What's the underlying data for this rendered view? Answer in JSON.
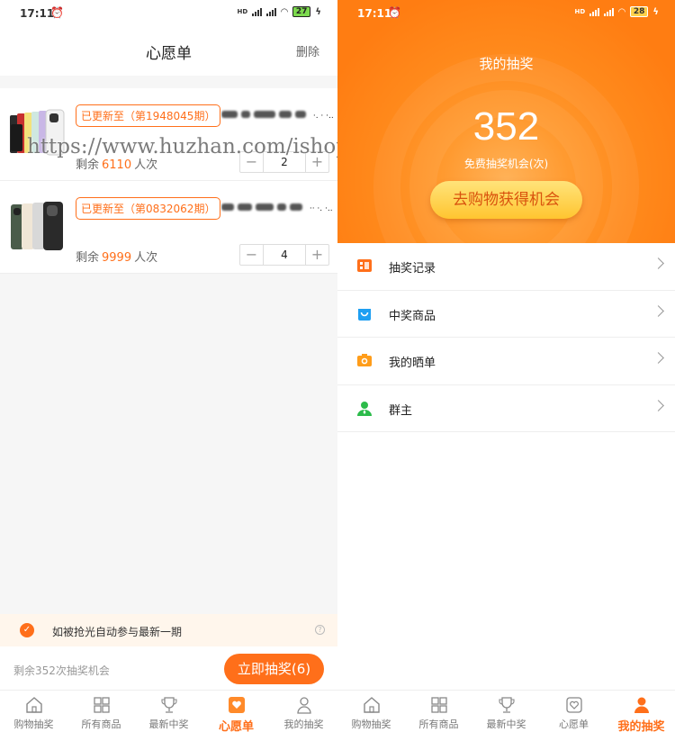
{
  "left": {
    "status": {
      "time": "17:11",
      "net": "HD",
      "battery": "27"
    },
    "header": {
      "title": "心愿单",
      "delete": "删除"
    },
    "items": [
      {
        "tag": "已更新至（第1948045期）",
        "name": "·. · ·..",
        "remain_prefix": "剩余",
        "remain": "6110",
        "remain_suffix": "人次",
        "qty": "2",
        "minus": "−",
        "plus": "+"
      },
      {
        "tag": "已更新至（第0832062期）",
        "name": "·· ·. ·..",
        "remain_prefix": "剩余",
        "remain": "9999",
        "remain_suffix": "人次",
        "qty": "4",
        "minus": "−",
        "plus": "+"
      }
    ],
    "watermark": "https://www.huzhan.com/ishop21730",
    "auto_join": {
      "check": "✓",
      "text": "如被抢光自动参与最新一期",
      "help": "?"
    },
    "draw_bar": {
      "remaining_text": "剩余352次抽奖机会",
      "button": "立即抽奖(6)"
    },
    "tabs": [
      {
        "label": "购物抽奖",
        "icon": "home-icon"
      },
      {
        "label": "所有商品",
        "icon": "grid-icon"
      },
      {
        "label": "最新中奖",
        "icon": "trophy-icon"
      },
      {
        "label": "心愿单",
        "icon": "wishlist-icon",
        "active": true
      },
      {
        "label": "我的抽奖",
        "icon": "user-icon"
      }
    ]
  },
  "right": {
    "status": {
      "time": "17:11",
      "net": "HD",
      "battery": "28"
    },
    "title": "我的抽奖",
    "count": "352",
    "count_label": "免费抽奖机会(次)",
    "button": "去购物获得机会",
    "menu": [
      {
        "label": "抽奖记录",
        "icon": "record-icon"
      },
      {
        "label": "中奖商品",
        "icon": "shopping-bag-icon"
      },
      {
        "label": "我的晒单",
        "icon": "camera-icon"
      },
      {
        "label": "群主",
        "icon": "group-owner-icon"
      }
    ],
    "tabs": [
      {
        "label": "购物抽奖",
        "icon": "home-icon"
      },
      {
        "label": "所有商品",
        "icon": "grid-icon"
      },
      {
        "label": "最新中奖",
        "icon": "trophy-icon"
      },
      {
        "label": "心愿单",
        "icon": "wishlist-icon"
      },
      {
        "label": "我的抽奖",
        "icon": "user-icon",
        "active": true
      }
    ]
  },
  "colors": {
    "accent": "#ff6f1a",
    "banner": "#ff8a1c",
    "button_gold": "#ffc530"
  }
}
